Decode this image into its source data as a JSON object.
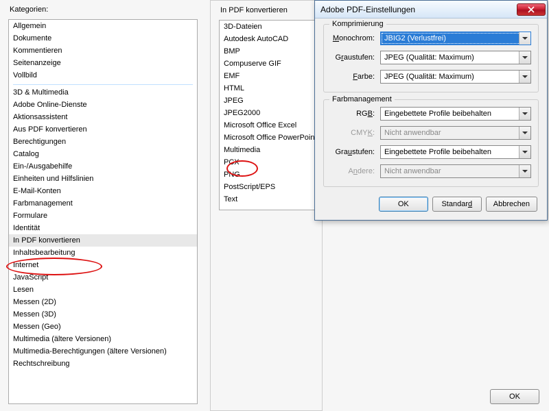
{
  "panels": {
    "kategorien_label": "Kategorien:",
    "inpdf_label": "In PDF konvertieren"
  },
  "kategorien": {
    "group1": [
      "Allgemein",
      "Dokumente",
      "Kommentieren",
      "Seitenanzeige",
      "Vollbild"
    ],
    "group2": [
      "3D & Multimedia",
      "Adobe Online-Dienste",
      "Aktionsassistent",
      "Aus PDF konvertieren",
      "Berechtigungen",
      "Catalog",
      "Ein-/Ausgabehilfe",
      "Einheiten und Hilfslinien",
      "E-Mail-Konten",
      "Farbmanagement",
      "Formulare",
      "Identität",
      "In PDF konvertieren",
      "Inhaltsbearbeitung",
      "Internet",
      "JavaScript",
      "Lesen",
      "Messen (2D)",
      "Messen (3D)",
      "Messen (Geo)",
      "Multimedia (ältere Versionen)",
      "Multimedia-Berechtigungen (ältere Versionen)",
      "Rechtschreibung"
    ],
    "selected": "In PDF konvertieren"
  },
  "formats": {
    "items": [
      "3D-Dateien",
      "Autodesk AutoCAD",
      "BMP",
      "Compuserve GIF",
      "EMF",
      "HTML",
      "JPEG",
      "JPEG2000",
      "Microsoft Office Excel",
      "Microsoft Office PowerPoint",
      "Multimedia",
      "PCX",
      "PNG",
      "PostScript/EPS",
      "Text"
    ]
  },
  "dialog": {
    "title": "Adobe PDF-Einstellungen",
    "komprimierung": {
      "legend": "Komprimierung",
      "monochrom_label": "Monochrom:",
      "monochrom_value": "JBIG2 (Verlustfrei)",
      "graustufen_label": "Graustufen:",
      "graustufen_value": "JPEG (Qualität: Maximum)",
      "farbe_label": "Farbe:",
      "farbe_value": "JPEG (Qualität: Maximum)"
    },
    "farbmanagement": {
      "legend": "Farbmanagement",
      "rgb_label": "RGB:",
      "rgb_value": "Eingebettete Profile beibehalten",
      "cmyk_label": "CMYK:",
      "cmyk_value": "Nicht anwendbar",
      "graustufen_label": "Graustufen:",
      "graustufen_value": "Eingebettete Profile beibehalten",
      "andere_label": "Andere:",
      "andere_value": "Nicht anwendbar"
    },
    "buttons": {
      "ok": "OK",
      "standard": "Standard",
      "abbrechen": "Abbrechen"
    }
  },
  "bottom": {
    "ok": "OK"
  }
}
